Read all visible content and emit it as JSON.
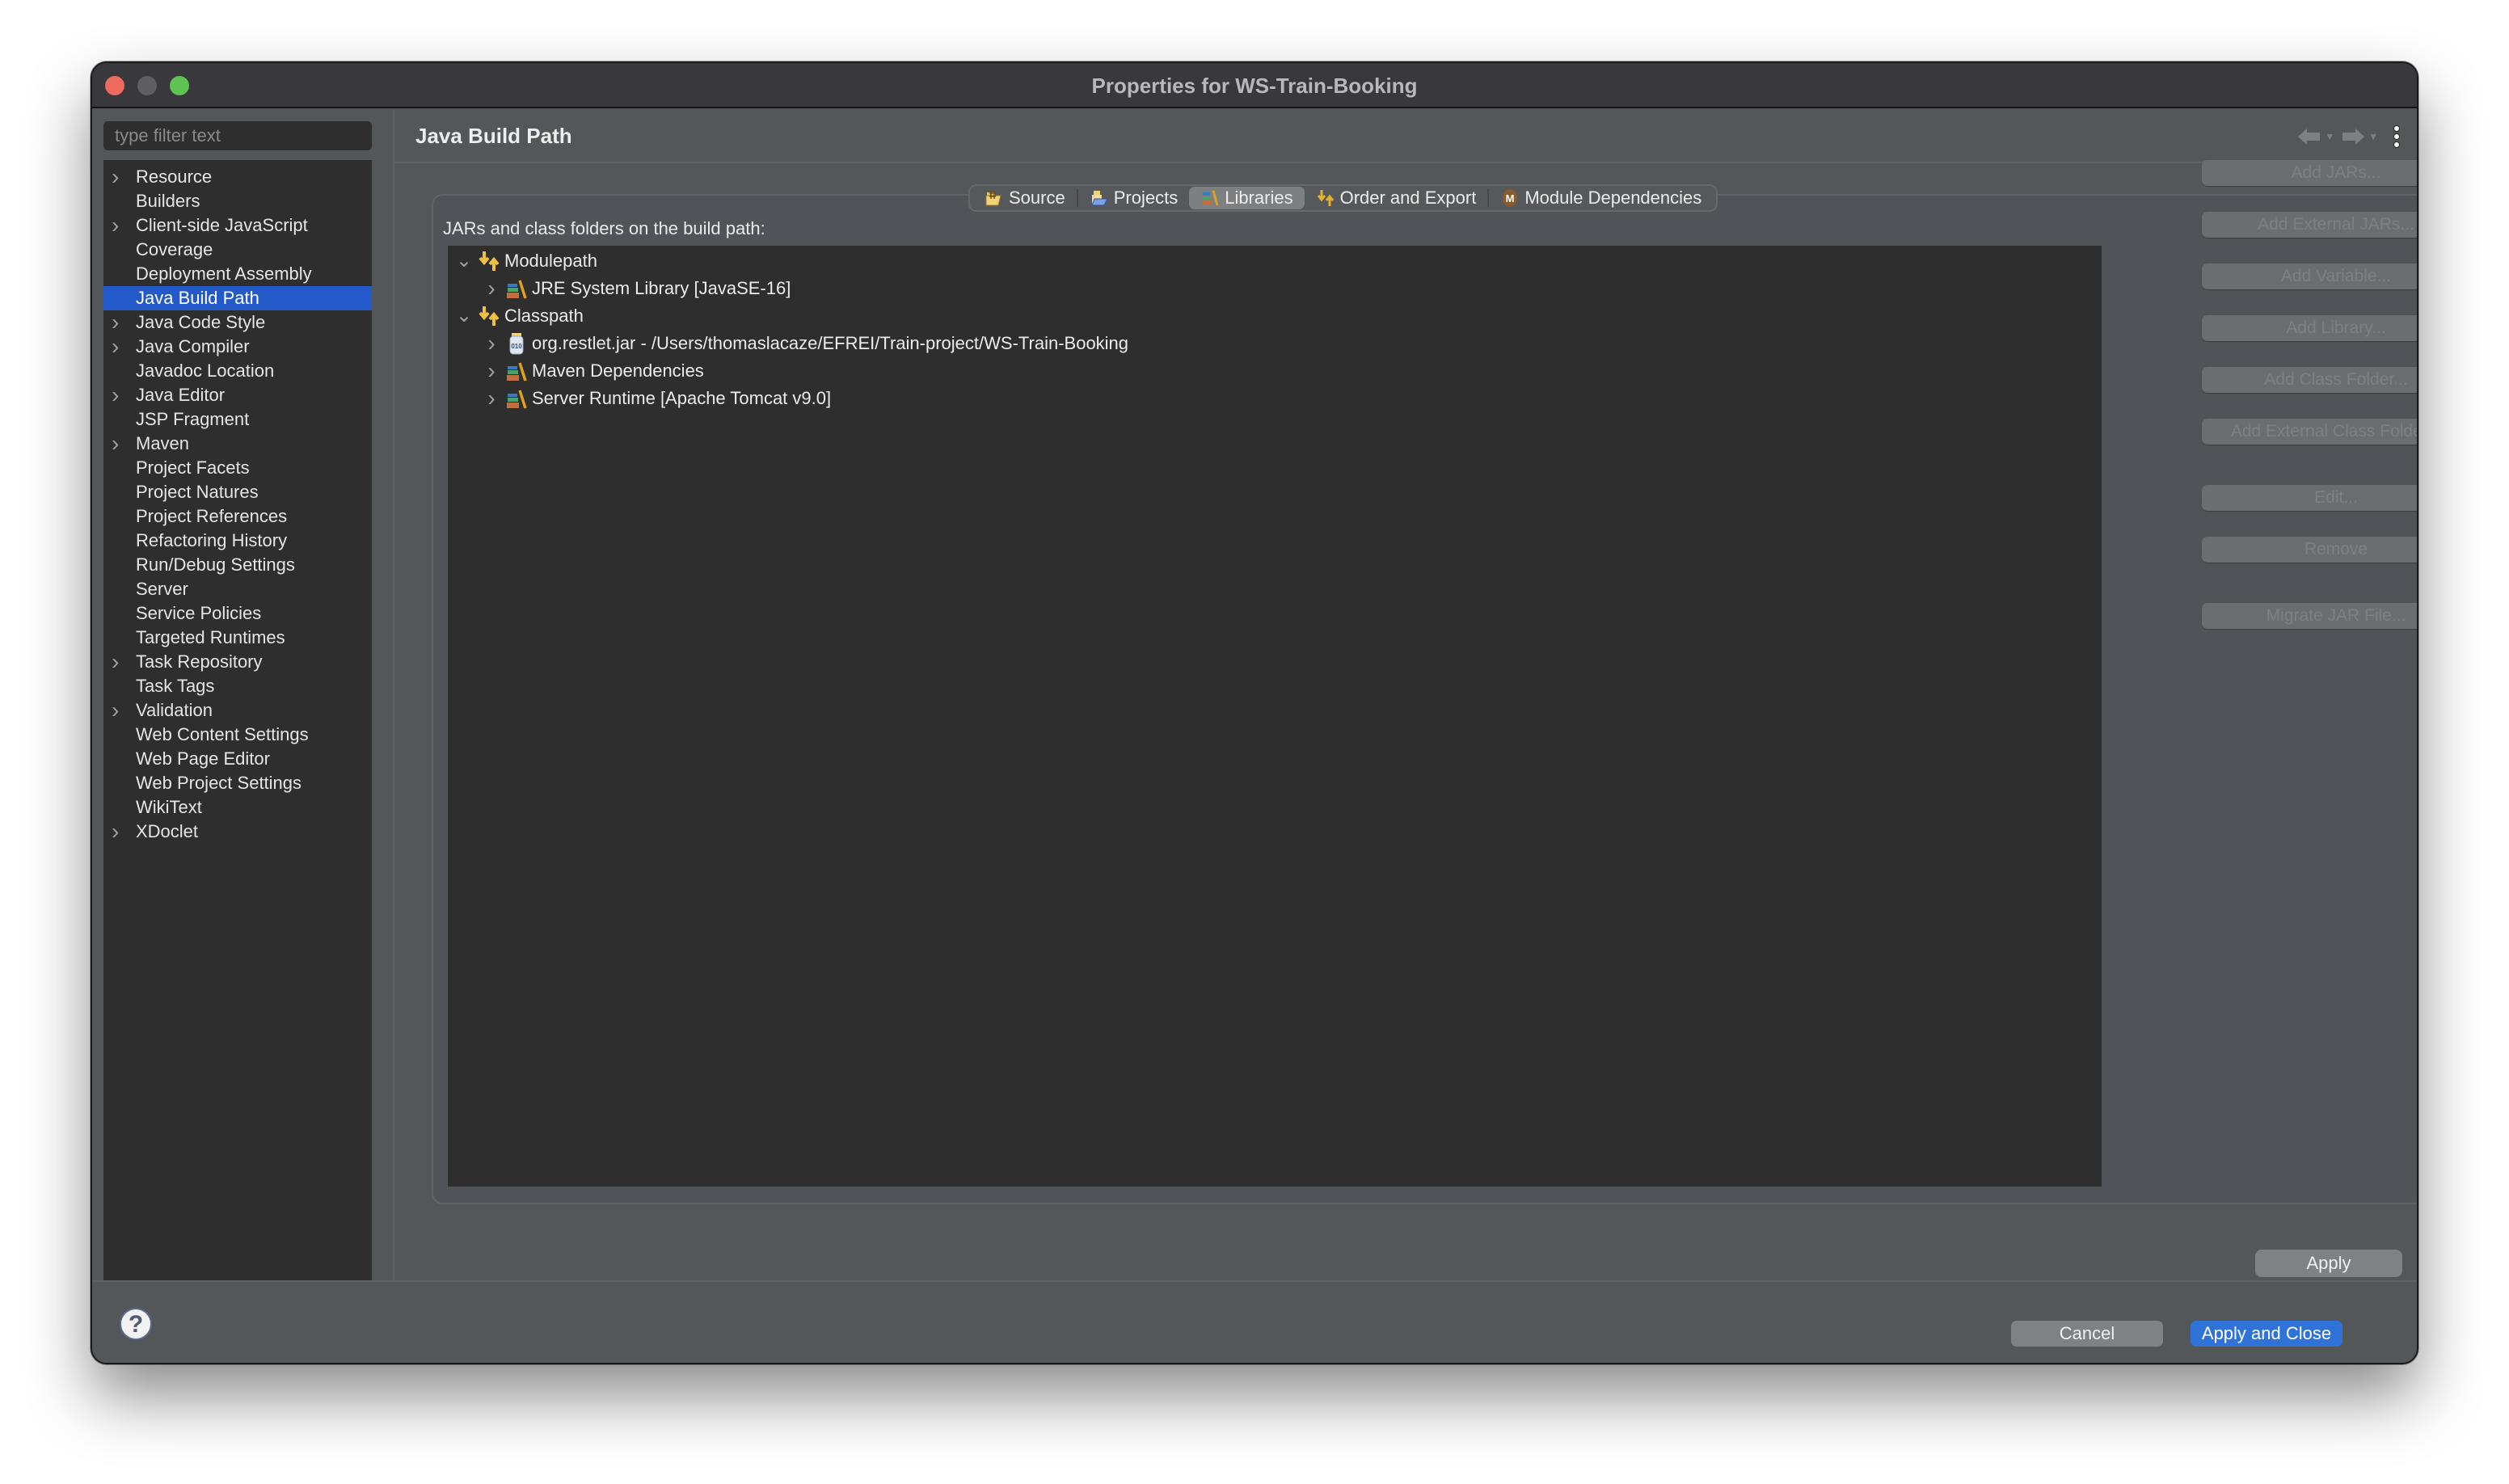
{
  "window": {
    "title": "Properties for WS-Train-Booking"
  },
  "sidebar": {
    "filter_placeholder": "type filter text",
    "items": [
      {
        "label": "Resource",
        "expandable": true
      },
      {
        "label": "Builders",
        "expandable": false
      },
      {
        "label": "Client-side JavaScript",
        "expandable": true
      },
      {
        "label": "Coverage",
        "expandable": false
      },
      {
        "label": "Deployment Assembly",
        "expandable": false
      },
      {
        "label": "Java Build Path",
        "expandable": false,
        "selected": true
      },
      {
        "label": "Java Code Style",
        "expandable": true
      },
      {
        "label": "Java Compiler",
        "expandable": true
      },
      {
        "label": "Javadoc Location",
        "expandable": false
      },
      {
        "label": "Java Editor",
        "expandable": true
      },
      {
        "label": "JSP Fragment",
        "expandable": false
      },
      {
        "label": "Maven",
        "expandable": true
      },
      {
        "label": "Project Facets",
        "expandable": false
      },
      {
        "label": "Project Natures",
        "expandable": false
      },
      {
        "label": "Project References",
        "expandable": false
      },
      {
        "label": "Refactoring History",
        "expandable": false
      },
      {
        "label": "Run/Debug Settings",
        "expandable": false
      },
      {
        "label": "Server",
        "expandable": false
      },
      {
        "label": "Service Policies",
        "expandable": false
      },
      {
        "label": "Targeted Runtimes",
        "expandable": false
      },
      {
        "label": "Task Repository",
        "expandable": true
      },
      {
        "label": "Task Tags",
        "expandable": false
      },
      {
        "label": "Validation",
        "expandable": true
      },
      {
        "label": "Web Content Settings",
        "expandable": false
      },
      {
        "label": "Web Page Editor",
        "expandable": false
      },
      {
        "label": "Web Project Settings",
        "expandable": false
      },
      {
        "label": "WikiText",
        "expandable": false
      },
      {
        "label": "XDoclet",
        "expandable": true
      }
    ]
  },
  "page": {
    "title": "Java Build Path",
    "back_icon": "back-arrow-icon",
    "forward_icon": "forward-arrow-icon",
    "more_icon": "vertical-dots-icon"
  },
  "tabs": [
    {
      "label": "Source",
      "icon": "source-folder-icon",
      "active": false
    },
    {
      "label": "Projects",
      "icon": "projects-folder-icon",
      "active": false
    },
    {
      "label": "Libraries",
      "icon": "library-books-icon",
      "active": true
    },
    {
      "label": "Order and Export",
      "icon": "order-arrows-icon",
      "active": false
    },
    {
      "label": "Module Dependencies",
      "icon": "module-m-icon",
      "active": false
    }
  ],
  "libraries": {
    "label": "JARs and class folders on the build path:",
    "tree": [
      {
        "label": "Modulepath",
        "level": 1,
        "expanded": true,
        "icon": "path-arrows-icon"
      },
      {
        "label": "JRE System Library [JavaSE-16]",
        "level": 2,
        "expanded": false,
        "icon": "library-icon"
      },
      {
        "label": "Classpath",
        "level": 1,
        "expanded": true,
        "icon": "path-arrows-icon"
      },
      {
        "label": "org.restlet.jar - /Users/thomaslacaze/EFREI/Train-project/WS-Train-Booking",
        "level": 2,
        "expanded": false,
        "icon": "jar-icon"
      },
      {
        "label": "Maven Dependencies",
        "level": 2,
        "expanded": false,
        "icon": "library-icon"
      },
      {
        "label": "Server Runtime [Apache Tomcat v9.0]",
        "level": 2,
        "expanded": false,
        "icon": "library-icon"
      }
    ],
    "buttons": [
      {
        "label": "Add JARs...",
        "enabled": false
      },
      {
        "label": "Add External JARs...",
        "enabled": false
      },
      {
        "label": "Add Variable...",
        "enabled": false
      },
      {
        "label": "Add Library...",
        "enabled": false
      },
      {
        "label": "Add Class Folder...",
        "enabled": false
      },
      {
        "label": "Add External Class Folder...",
        "enabled": false
      },
      {
        "label": "Edit...",
        "enabled": false
      },
      {
        "label": "Remove",
        "enabled": false
      },
      {
        "label": "Migrate JAR File...",
        "enabled": false
      }
    ]
  },
  "footer": {
    "apply_label": "Apply",
    "cancel_label": "Cancel",
    "apply_close_label": "Apply and Close"
  },
  "colors": {
    "selection": "#2359c9",
    "primary_button": "#2f73d9",
    "tree_background": "#2e2e2e",
    "panel_background": "#53575a"
  }
}
